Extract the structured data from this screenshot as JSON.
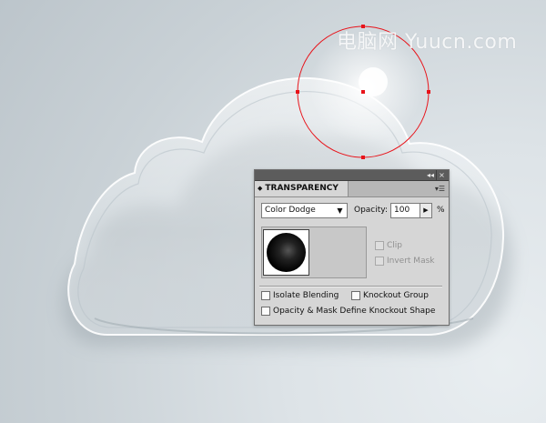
{
  "watermark": "电脑网 Yuucn.com",
  "panel": {
    "title": "TRANSPARENCY",
    "collapse_glyph": "◂◂",
    "close_glyph": "×",
    "menu_glyph": "▾☰",
    "blend_mode": "Color Dodge",
    "opacity_label": "Opacity:",
    "opacity_value": "100",
    "opacity_unit": "%",
    "checkboxes": {
      "clip": {
        "label": "Clip",
        "checked": false,
        "enabled": false
      },
      "invert_mask": {
        "label": "Invert Mask",
        "checked": false,
        "enabled": false
      },
      "isolate_blending": {
        "label": "Isolate Blending",
        "checked": false,
        "enabled": true
      },
      "knockout_group": {
        "label": "Knockout Group",
        "checked": false,
        "enabled": true
      },
      "opacity_mask_knockout": {
        "label": "Opacity & Mask Define Knockout Shape",
        "checked": false,
        "enabled": true
      }
    }
  },
  "colors": {
    "selection_red": "#e8131a",
    "panel_bg": "#d6d6d6",
    "panel_header": "#5c5c5c"
  }
}
